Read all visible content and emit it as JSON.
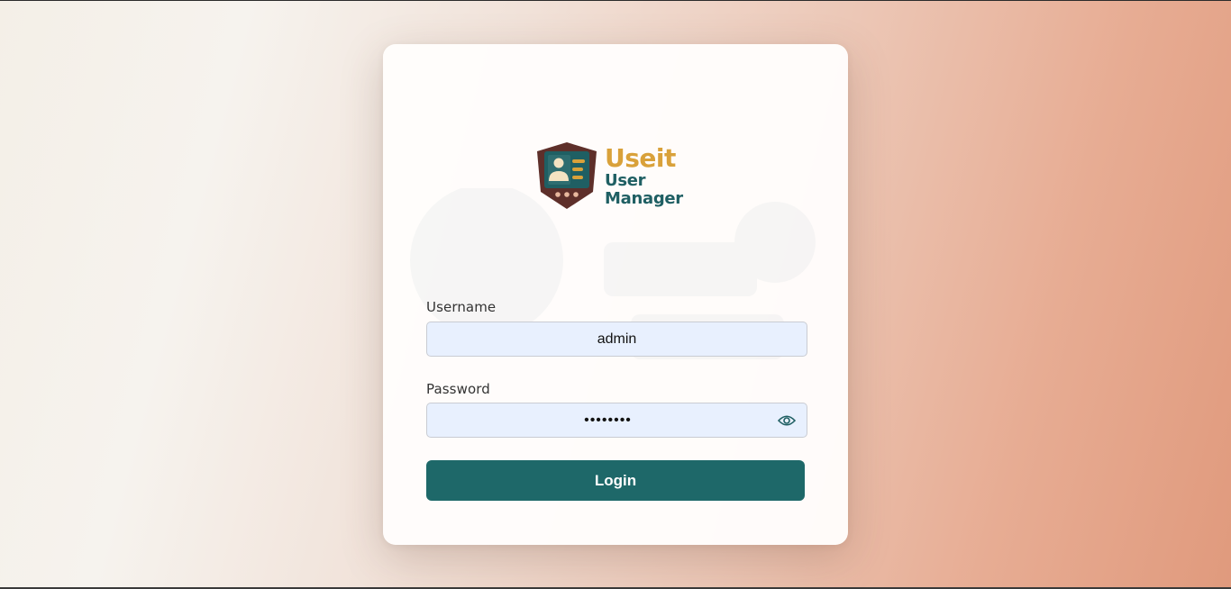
{
  "logo": {
    "brand": "Useit",
    "line1": "User",
    "line2": "Manager",
    "icon": "user-card-shield-icon"
  },
  "form": {
    "username": {
      "label": "Username",
      "value": "admin"
    },
    "password": {
      "label": "Password",
      "value": "••••••••",
      "toggle_icon": "eye-icon"
    },
    "login_label": "Login"
  },
  "colors": {
    "brand_gold": "#d9a13a",
    "brand_teal": "#1f5f63",
    "button": "#1e6869",
    "shield": "#5e2f2a",
    "input_bg": "#e8f0fe"
  }
}
